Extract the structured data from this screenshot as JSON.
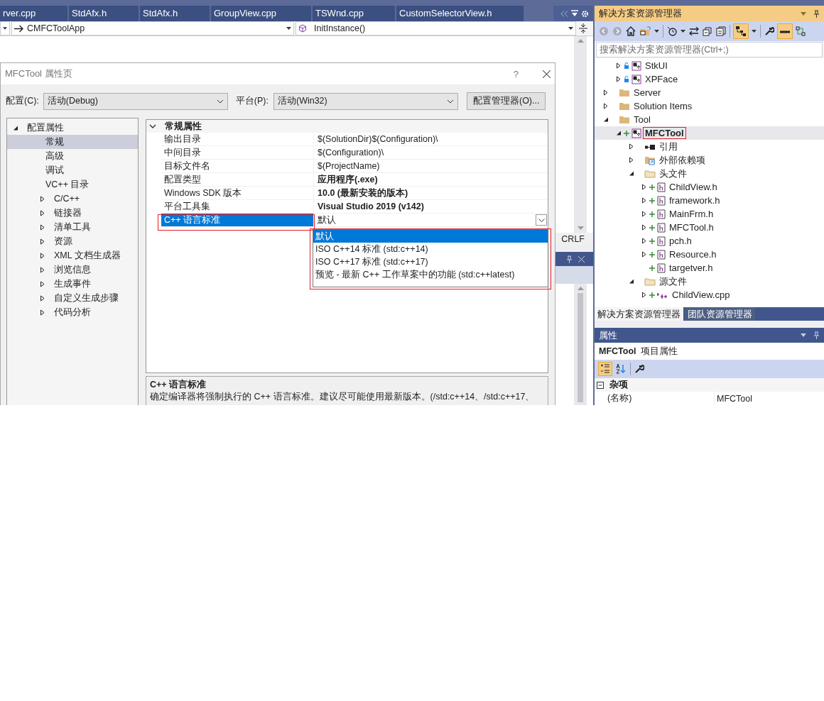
{
  "editor": {
    "tabs": [
      {
        "label": "rver.cpp",
        "selected": false
      },
      {
        "label": "StdAfx.h",
        "selected": false
      },
      {
        "label": "StdAfx.h",
        "selected": false
      },
      {
        "label": "GroupView.cpp",
        "selected": false
      },
      {
        "label": "TSWnd.cpp",
        "selected": false
      },
      {
        "label": "CustomSelectorView.h",
        "selected": false
      }
    ],
    "nav": {
      "class_combo": "CMFCToolApp",
      "member_combo": "InitInstance()"
    },
    "status_bar": {
      "line_ending": "CRLF"
    }
  },
  "dialog": {
    "title": "MFCTool 属性页",
    "help": "?",
    "config_label": "配置(C):",
    "config_value": "活动(Debug)",
    "platform_label": "平台(P):",
    "platform_value": "活动(Win32)",
    "manager_button": "配置管理器(O)...",
    "tree": [
      {
        "label": "配置属性",
        "expanded": true,
        "selected": false,
        "children": [
          {
            "label": "常规",
            "selected": true
          },
          {
            "label": "高级",
            "selected": false
          },
          {
            "label": "调试",
            "selected": false
          },
          {
            "label": "VC++ 目录",
            "selected": false
          },
          {
            "label": "C/C++",
            "expanded": false,
            "selected": false
          },
          {
            "label": "链接器",
            "expanded": false,
            "selected": false
          },
          {
            "label": "清单工具",
            "expanded": false,
            "selected": false
          },
          {
            "label": "资源",
            "expanded": false,
            "selected": false
          },
          {
            "label": "XML 文档生成器",
            "expanded": false,
            "selected": false
          },
          {
            "label": "浏览信息",
            "expanded": false,
            "selected": false
          },
          {
            "label": "生成事件",
            "expanded": false,
            "selected": false
          },
          {
            "label": "自定义生成步骤",
            "expanded": false,
            "selected": false
          },
          {
            "label": "代码分析",
            "expanded": false,
            "selected": false
          }
        ]
      }
    ],
    "grid": {
      "category": "常规属性",
      "expanded": true,
      "rows": [
        {
          "name": "输出目录",
          "value": "$(SolutionDir)$(Configuration)\\",
          "bold": false,
          "selected": false
        },
        {
          "name": "中间目录",
          "value": "$(Configuration)\\",
          "bold": false,
          "selected": false
        },
        {
          "name": "目标文件名",
          "value": "$(ProjectName)",
          "bold": false,
          "selected": false
        },
        {
          "name": "配置类型",
          "value": "应用程序(.exe)",
          "bold": true,
          "selected": false
        },
        {
          "name": "Windows SDK 版本",
          "value": "10.0 (最新安装的版本)",
          "bold": true,
          "selected": false
        },
        {
          "name": "平台工具集",
          "value": "Visual Studio 2019 (v142)",
          "bold": true,
          "selected": false
        },
        {
          "name": "C++ 语言标准",
          "value": "默认",
          "bold": false,
          "selected": true
        }
      ]
    },
    "dropdown": [
      {
        "label": "默认",
        "selected": true
      },
      {
        "label": "ISO C++14 标准 (std:c++14)",
        "selected": false
      },
      {
        "label": "ISO C++17 标准 (std:c++17)",
        "selected": false
      },
      {
        "label": "预览 - 最新 C++ 工作草案中的功能 (std:c++latest)",
        "selected": false
      }
    ],
    "description": {
      "title": "C++ 语言标准",
      "text": "确定编译器将强制执行的 C++ 语言标准。建议尽可能使用最新版本。(/std:c++14、/std:c++17、"
    }
  },
  "solution_explorer": {
    "title": "解决方案资源管理器",
    "search_placeholder": "搜索解决方案资源管理器(Ctrl+;)",
    "partial_group": [
      {
        "label": "StkUI",
        "kind": "project",
        "locked": true,
        "expanded": false,
        "selected": false
      },
      {
        "label": "XPFace",
        "kind": "project",
        "locked": true,
        "expanded": false,
        "selected": false
      }
    ],
    "items": [
      {
        "label": "Server",
        "kind": "folder",
        "added": false,
        "expanded": false,
        "selected": false
      },
      {
        "label": "Solution Items",
        "kind": "folder",
        "added": false,
        "expanded": false,
        "selected": false
      },
      {
        "label": "Tool",
        "kind": "folder",
        "added": false,
        "expanded": true,
        "selected": false,
        "children": [
          {
            "label": "MFCTool",
            "kind": "project",
            "added": true,
            "expanded": true,
            "selected": true,
            "children": [
              {
                "label": "引用",
                "kind": "references",
                "added": false,
                "expanded": false,
                "selected": false
              },
              {
                "label": "外部依赖项",
                "kind": "external",
                "added": false,
                "expanded": false,
                "selected": false
              },
              {
                "label": "头文件",
                "kind": "filter",
                "added": false,
                "expanded": true,
                "selected": false,
                "children": [
                  {
                    "label": "ChildView.h",
                    "kind": "header",
                    "added": true,
                    "expanded": false,
                    "selected": false
                  },
                  {
                    "label": "framework.h",
                    "kind": "header",
                    "added": true,
                    "expanded": false,
                    "selected": false
                  },
                  {
                    "label": "MainFrm.h",
                    "kind": "header",
                    "added": true,
                    "expanded": false,
                    "selected": false
                  },
                  {
                    "label": "MFCTool.h",
                    "kind": "header",
                    "added": true,
                    "expanded": false,
                    "selected": false
                  },
                  {
                    "label": "pch.h",
                    "kind": "header",
                    "added": true,
                    "expanded": false,
                    "selected": false
                  },
                  {
                    "label": "Resource.h",
                    "kind": "header",
                    "added": true,
                    "expanded": false,
                    "selected": false
                  },
                  {
                    "label": "targetver.h",
                    "kind": "header",
                    "added": true,
                    "selected": false
                  }
                ]
              },
              {
                "label": "源文件",
                "kind": "filter",
                "added": false,
                "expanded": true,
                "selected": false,
                "children": [
                  {
                    "label": "ChildView.cpp",
                    "kind": "source",
                    "added": true,
                    "expanded": false,
                    "selected": false
                  }
                ]
              }
            ]
          }
        ]
      }
    ],
    "tabs": [
      {
        "label": "解决方案资源管理器",
        "selected": true
      },
      {
        "label": "团队资源管理器",
        "selected": false
      }
    ]
  },
  "properties": {
    "title": "属性",
    "object_name": "MFCTool",
    "object_type": "项目属性",
    "category": "杂项",
    "rows": [
      {
        "name": "(名称)",
        "value": "MFCTool"
      }
    ]
  }
}
